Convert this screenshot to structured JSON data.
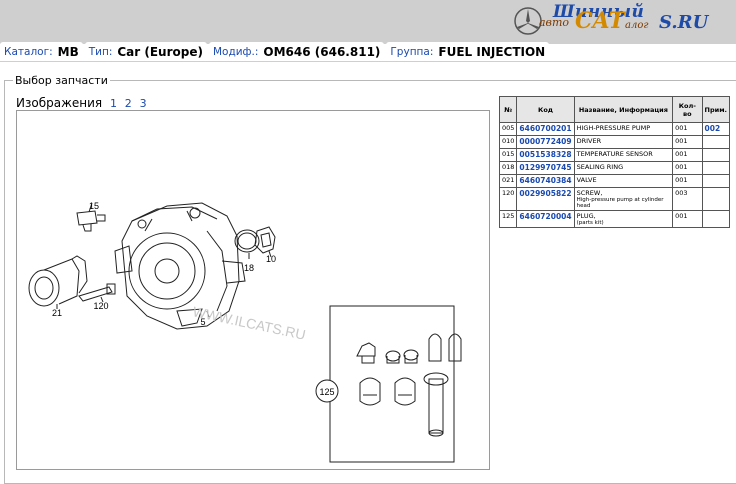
{
  "logo": {
    "part1": "Шинный",
    "part2": "авто",
    "part3": "CAT",
    "part4": "алог",
    "part5": "S.RU"
  },
  "tabs": [
    {
      "label": "Каталог:",
      "value": "MB"
    },
    {
      "label": "Тип:",
      "value": "Car (Europe)"
    },
    {
      "label": "Модиф.:",
      "value": "OM646 (646.811)"
    },
    {
      "label": "Группа:",
      "value": "FUEL INJECTION"
    }
  ],
  "panel_title": "Выбор запчасти",
  "images": {
    "label": "Изображения",
    "pages": [
      "1",
      "2",
      "3"
    ]
  },
  "diagram": {
    "callouts": [
      "15",
      "10",
      "18",
      "21",
      "120",
      "5",
      "125"
    ],
    "watermark": "WWW.ILCATS.RU"
  },
  "table": {
    "headers": [
      "№",
      "Код",
      "Название, Информация",
      "Кол-во",
      "Прим."
    ],
    "rows": [
      {
        "no": "005",
        "code": "6460700201",
        "name": "HIGH-PRESSURE PUMP",
        "qty": "001",
        "note": "002"
      },
      {
        "no": "010",
        "code": "0000772409",
        "name": "DRIVER",
        "qty": "001",
        "note": ""
      },
      {
        "no": "015",
        "code": "0051538328",
        "name": "TEMPERATURE SENSOR",
        "qty": "001",
        "note": ""
      },
      {
        "no": "018",
        "code": "0129970745",
        "name": "SEALING RING",
        "qty": "001",
        "note": ""
      },
      {
        "no": "021",
        "code": "6460740384",
        "name": "VALVE",
        "qty": "001",
        "note": ""
      },
      {
        "no": "120",
        "code": "0029905822",
        "name": "SCREW,",
        "sub": "High-pressure pump at cylinder head",
        "qty": "003",
        "note": ""
      },
      {
        "no": "125",
        "code": "6460720004",
        "name": "PLUG,",
        "sub": "(parts kit)",
        "qty": "001",
        "note": ""
      }
    ]
  },
  "colors": {
    "header_bg": "#cfcfcf",
    "link": "#1a4ab0",
    "table_header_bg": "#e6e6e6"
  }
}
